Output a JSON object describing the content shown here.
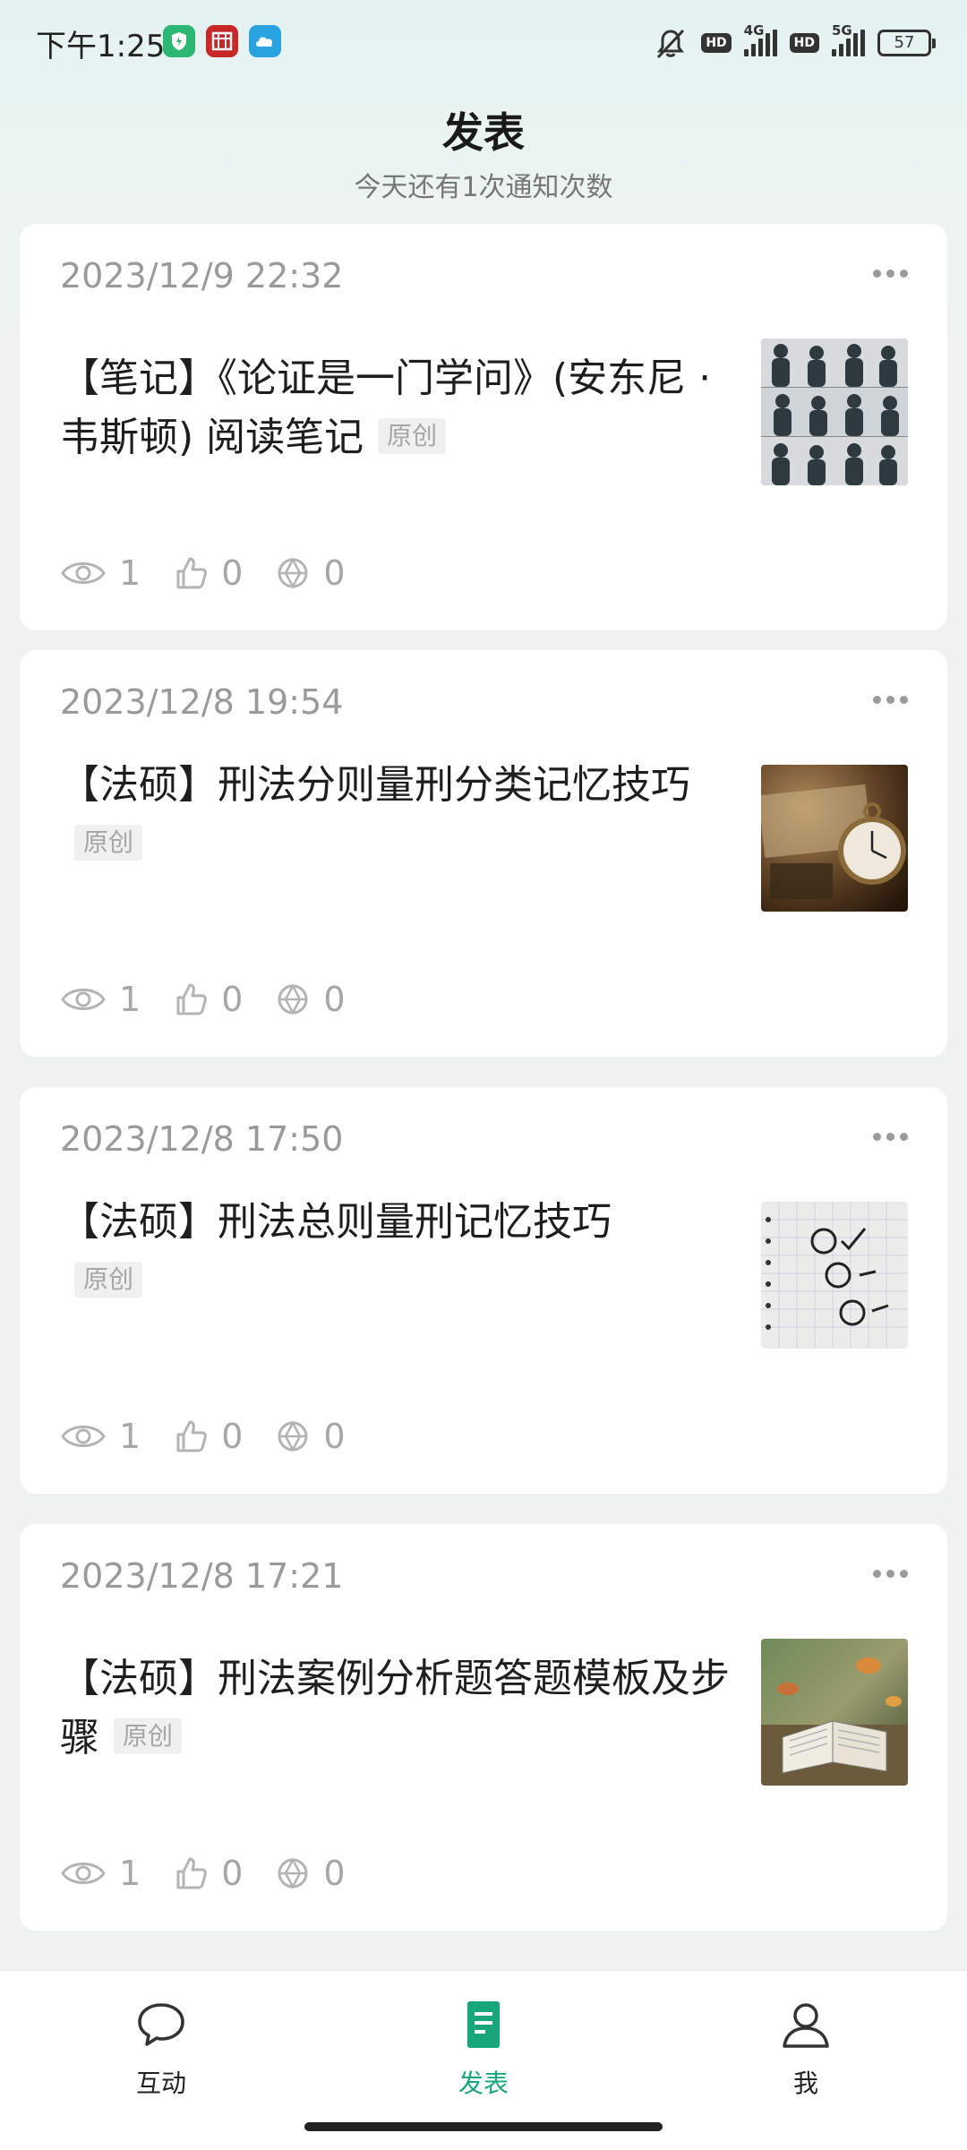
{
  "status_bar": {
    "time": "下午1:25",
    "app_icon_3_text": "",
    "signal_1": "4G",
    "signal_2": "5G",
    "battery": "57"
  },
  "header": {
    "title": "发表",
    "subtitle": "今天还有1次通知次数"
  },
  "articles": [
    {
      "date": "2023/12/9 22:32",
      "title": "【笔记】《论证是一门学问》(安东尼 · 韦斯顿) 阅读笔记",
      "tag": "原创",
      "views": "1",
      "likes": "0",
      "shares": "0",
      "thumbnail": "silhouettes-thumbnail"
    },
    {
      "date": "2023/12/8 19:54",
      "title": "【法硕】刑法分则量刑分类记忆技巧",
      "tag": "原创",
      "views": "1",
      "likes": "0",
      "shares": "0",
      "thumbnail": "pocket-watch-thumbnail"
    },
    {
      "date": "2023/12/8 17:50",
      "title": "【法硕】刑法总则量刑记忆技巧",
      "tag": "原创",
      "views": "1",
      "likes": "0",
      "shares": "0",
      "thumbnail": "checklist-thumbnail"
    },
    {
      "date": "2023/12/8 17:21",
      "title": "【法硕】刑法案例分析题答题模板及步骤",
      "tag": "原创",
      "views": "1",
      "likes": "0",
      "shares": "0",
      "thumbnail": "open-book-thumbnail"
    }
  ],
  "bottom_nav": {
    "items": [
      {
        "label": "互动",
        "icon": "chat-bubble-icon"
      },
      {
        "label": "发表",
        "icon": "document-icon"
      },
      {
        "label": "我",
        "icon": "person-icon"
      }
    ],
    "active": "发表",
    "accent": "#17a67a"
  }
}
